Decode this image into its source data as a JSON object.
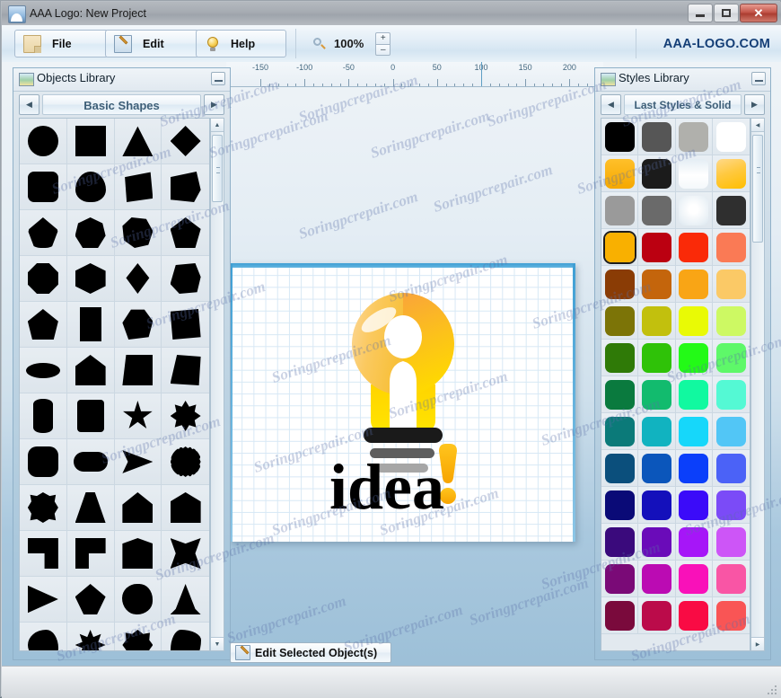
{
  "window": {
    "title": "AAA Logo: New Project",
    "icon": "app-logo-icon",
    "minimize_label": "",
    "maximize_label": "",
    "close_label": "✕"
  },
  "toolbar": {
    "buttons": [
      {
        "label": "File",
        "icon": "file-icon"
      },
      {
        "label": "Edit",
        "icon": "pencil-edit-icon"
      },
      {
        "label": "Help",
        "icon": "lightbulb-help-icon"
      }
    ],
    "zoom": {
      "icon": "magnifier-icon",
      "value": "100%",
      "increase": "+",
      "decrease": "–"
    },
    "brand": "AAA-LOGO.COM"
  },
  "objects_library": {
    "title": "Objects Library",
    "icon": "library-panel-icon",
    "minimize": "_",
    "category": "Basic Shapes",
    "prev_arrow": "◀",
    "next_arrow": "▶",
    "scroll_up": "▲",
    "scroll_down": "▼",
    "shapes": [
      "circle",
      "square",
      "triangle",
      "diamond",
      "rounded-square",
      "egg",
      "cube-front",
      "parallelogram-cut",
      "teardrop",
      "heptagon",
      "heptagon-rotated",
      "pentagon",
      "octagon",
      "cube-3d",
      "rhombus",
      "heptagon-wide",
      "pentagon-tall",
      "rectangle-tall",
      "hexagon-round",
      "square-cut",
      "ellipse",
      "home-plate",
      "trapezoid",
      "square-folded",
      "cylinder",
      "rectangle-rounded",
      "star-5",
      "starburst-8",
      "square-round",
      "pill",
      "arrow-right-shape",
      "gear-circle",
      "blob-star",
      "trapezoid-round",
      "house",
      "house-wide",
      "l-shape",
      "l-shape-flipped",
      "arch",
      "concave-square",
      "play-triangle",
      "rounded-diamond",
      "blob-circle",
      "cone",
      "blob",
      "star-8-sharp",
      "star-7-curved",
      "flower-8"
    ]
  },
  "styles_library": {
    "title": "Styles Library",
    "icon": "library-panel-icon",
    "minimize": "_",
    "category": "Last Styles & Solid",
    "prev_arrow": "◀",
    "next_arrow": "▶",
    "swatches": [
      {
        "name": "black",
        "color": "#000000",
        "selected": false
      },
      {
        "name": "dark-gray",
        "color": "#565656",
        "selected": false
      },
      {
        "name": "light-gray",
        "color": "#b0b0ac",
        "selected": false
      },
      {
        "name": "white",
        "color": "#ffffff",
        "selected": false
      },
      {
        "name": "amber-gradient",
        "color": "#f5a800",
        "selected": false
      },
      {
        "name": "near-black",
        "color": "#1b1b1b",
        "selected": false
      },
      {
        "name": "white-gradient",
        "color": "#eef4f8",
        "selected": false
      },
      {
        "name": "gold-gloss",
        "color": "#fbc33a",
        "selected": false
      },
      {
        "name": "gray",
        "color": "#9a9a9a",
        "selected": false
      },
      {
        "name": "mid-gray",
        "color": "#6a6a6a",
        "selected": false
      },
      {
        "name": "white-radial",
        "color": "#f4f8fb",
        "selected": false
      },
      {
        "name": "charcoal",
        "color": "#2f2f2f",
        "selected": false
      },
      {
        "name": "orange-yellow",
        "color": "#f9b000",
        "selected": true
      },
      {
        "name": "dark-red",
        "color": "#bb0011",
        "selected": false
      },
      {
        "name": "red",
        "color": "#fa2a08",
        "selected": false
      },
      {
        "name": "salmon",
        "color": "#fa7a55",
        "selected": false
      },
      {
        "name": "brown",
        "color": "#8a3c05",
        "selected": false
      },
      {
        "name": "burnt-orange",
        "color": "#c4650c",
        "selected": false
      },
      {
        "name": "orange",
        "color": "#f9a515",
        "selected": false
      },
      {
        "name": "light-orange",
        "color": "#fbc966",
        "selected": false
      },
      {
        "name": "olive",
        "color": "#7c7407",
        "selected": false
      },
      {
        "name": "dark-yellow",
        "color": "#c2c00d",
        "selected": false
      },
      {
        "name": "yellow",
        "color": "#e9fa05",
        "selected": false
      },
      {
        "name": "light-yellow",
        "color": "#cdf963",
        "selected": false
      },
      {
        "name": "dark-green",
        "color": "#2f7a07",
        "selected": false
      },
      {
        "name": "green",
        "color": "#2fc208",
        "selected": false
      },
      {
        "name": "bright-green",
        "color": "#23fa17",
        "selected": false
      },
      {
        "name": "light-green",
        "color": "#5ef869",
        "selected": false
      },
      {
        "name": "forest",
        "color": "#0a7a3e",
        "selected": false
      },
      {
        "name": "emerald",
        "color": "#12bb6e",
        "selected": false
      },
      {
        "name": "spring-green",
        "color": "#11f9a0",
        "selected": false
      },
      {
        "name": "aquamarine",
        "color": "#54f9d4",
        "selected": false
      },
      {
        "name": "teal-dark",
        "color": "#0b7a79",
        "selected": false
      },
      {
        "name": "teal",
        "color": "#11b3c0",
        "selected": false
      },
      {
        "name": "cyan",
        "color": "#16d7fa",
        "selected": false
      },
      {
        "name": "sky",
        "color": "#52c6f6",
        "selected": false
      },
      {
        "name": "navy-teal",
        "color": "#0b4f7c",
        "selected": false
      },
      {
        "name": "blue",
        "color": "#0b56bb",
        "selected": false
      },
      {
        "name": "bright-blue",
        "color": "#0b3ffa",
        "selected": false
      },
      {
        "name": "cornflower",
        "color": "#4b62f7",
        "selected": false
      },
      {
        "name": "navy",
        "color": "#0a0a77",
        "selected": false
      },
      {
        "name": "dark-blue",
        "color": "#1410bb",
        "selected": false
      },
      {
        "name": "violet-blue",
        "color": "#3b0bf9",
        "selected": false
      },
      {
        "name": "light-violet",
        "color": "#7b4bf7",
        "selected": false
      },
      {
        "name": "indigo",
        "color": "#3a0a7c",
        "selected": false
      },
      {
        "name": "purple",
        "color": "#6a0bb9",
        "selected": false
      },
      {
        "name": "bright-purple",
        "color": "#a616f8",
        "selected": false
      },
      {
        "name": "orchid",
        "color": "#cd55f7",
        "selected": false
      },
      {
        "name": "dark-magenta",
        "color": "#7a0a77",
        "selected": false
      },
      {
        "name": "magenta",
        "color": "#bb0bb3",
        "selected": false
      },
      {
        "name": "pink-magenta",
        "color": "#f911b9",
        "selected": false
      },
      {
        "name": "hot-pink",
        "color": "#f955a5",
        "selected": false
      },
      {
        "name": "maroon",
        "color": "#7a0a3c",
        "selected": false
      },
      {
        "name": "crimson",
        "color": "#bb0b4a",
        "selected": false
      },
      {
        "name": "rose-red",
        "color": "#f90b44",
        "selected": false
      },
      {
        "name": "coral-red",
        "color": "#f95555",
        "selected": false
      }
    ]
  },
  "canvas": {
    "ruler_marks": [
      "-150",
      "-100",
      "-50",
      "0",
      "50",
      "100",
      "150",
      "200"
    ],
    "logo_text": "idea",
    "logo_exclamation": "!",
    "logo_bulb_icon": "lightbulb-logo-icon"
  },
  "footer": {
    "edit_selected_label": "Edit Selected Object(s)",
    "edit_selected_icon": "pencil-edit-icon"
  },
  "watermark": {
    "text": "Soringpcrepair.com"
  }
}
